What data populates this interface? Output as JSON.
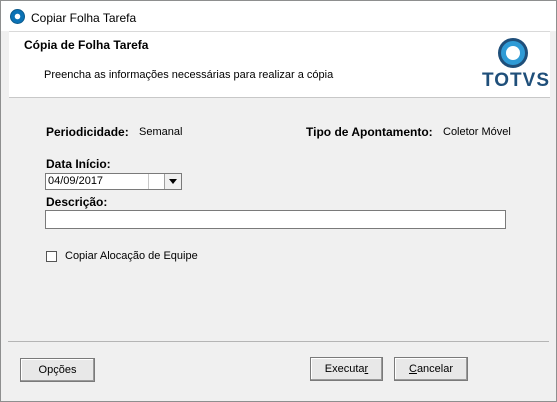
{
  "window": {
    "title": "Copiar Folha Tarefa"
  },
  "header": {
    "title": "Cópia de Folha Tarefa",
    "subtitle": "Preencha as informações necessárias para realizar a cópia",
    "logo_text": "TOTVS"
  },
  "form": {
    "periodicidade_label": "Periodicidade:",
    "periodicidade_value": "Semanal",
    "tipo_label": "Tipo de Apontamento:",
    "tipo_value": "Coletor Móvel",
    "data_inicio_label": "Data Início:",
    "data_inicio_value": "04/09/2017",
    "descricao_label": "Descrição:",
    "descricao_value": "",
    "copiar_alocacao_label": "Copiar Alocação de Equipe",
    "copiar_alocacao_checked": false
  },
  "buttons": {
    "opcoes": "Opções",
    "executar_pre": "Executa",
    "executar_u": "r",
    "cancelar_u": "C",
    "cancelar_post": "ancelar"
  }
}
